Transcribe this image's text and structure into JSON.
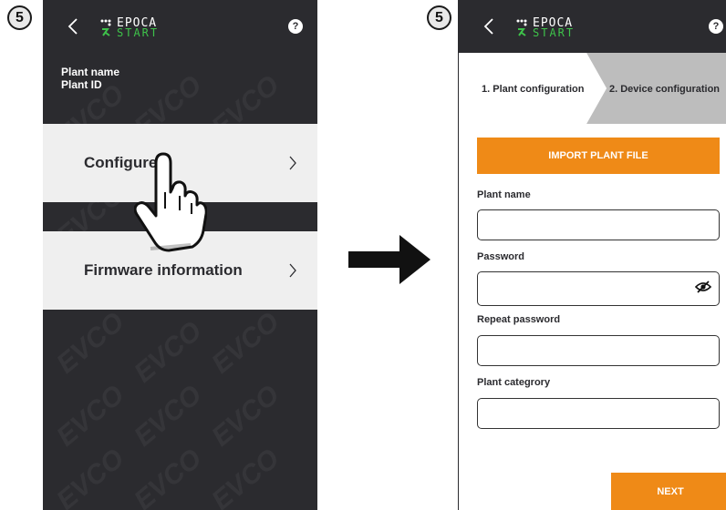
{
  "step_number": "5",
  "left_screen": {
    "app_logo": {
      "word1": "EPOCA",
      "word2": "START"
    },
    "help_label": "?",
    "plant_info": {
      "name": "Plant name",
      "id": "Plant ID"
    },
    "menu_items": [
      {
        "label": "Configure"
      },
      {
        "label": "Firmware information"
      }
    ],
    "watermark_text": "EVCO"
  },
  "right_screen": {
    "app_logo": {
      "word1": "EPOCA",
      "word2": "START"
    },
    "help_label": "?",
    "wizard_steps": [
      {
        "label": "1. Plant configuration",
        "active": true
      },
      {
        "label": "2. Device configuration",
        "active": false
      }
    ],
    "import_button": "IMPORT PLANT FILE",
    "fields": [
      {
        "label": "Plant name",
        "value": ""
      },
      {
        "label": "Password",
        "value": "",
        "icon": "eye-slash-icon"
      },
      {
        "label": "Repeat password",
        "value": ""
      },
      {
        "label": "Plant categrory",
        "value": ""
      }
    ],
    "next_button": "NEXT"
  },
  "colors": {
    "dark_bg": "#2b2b2f",
    "accent_orange": "#ef8a17",
    "logo_green": "#3ec24a",
    "menu_bg": "#efefef",
    "inactive_step": "#bdbdbd"
  }
}
